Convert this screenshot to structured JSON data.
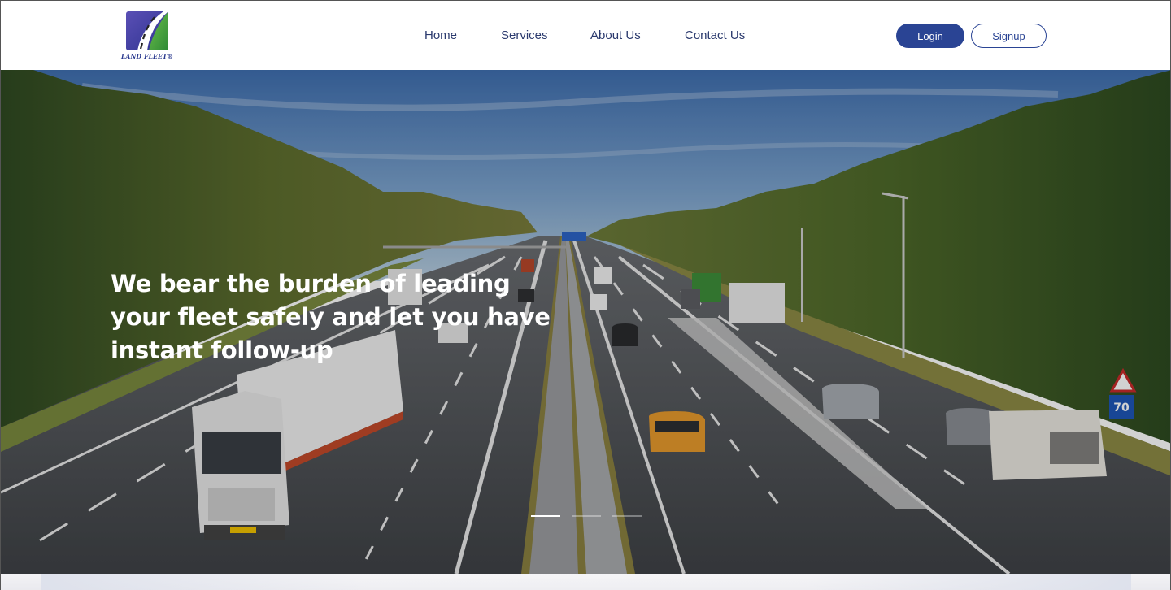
{
  "brand": {
    "logo_text": "LAND FLEET®",
    "colors": {
      "primary": "#2a4494",
      "logo_blue": "#3b3f9e",
      "logo_green": "#3d9c3f"
    }
  },
  "nav": {
    "items": [
      {
        "label": "Home"
      },
      {
        "label": "Services"
      },
      {
        "label": "About Us"
      },
      {
        "label": "Contact Us"
      }
    ]
  },
  "auth": {
    "login_label": "Login",
    "signup_label": "Signup"
  },
  "hero": {
    "title": "We bear the burden of leading your fleet safely and let you have instant follow-up",
    "background_icon": "highway-photo",
    "slides": {
      "count": 3,
      "active": 1
    }
  }
}
